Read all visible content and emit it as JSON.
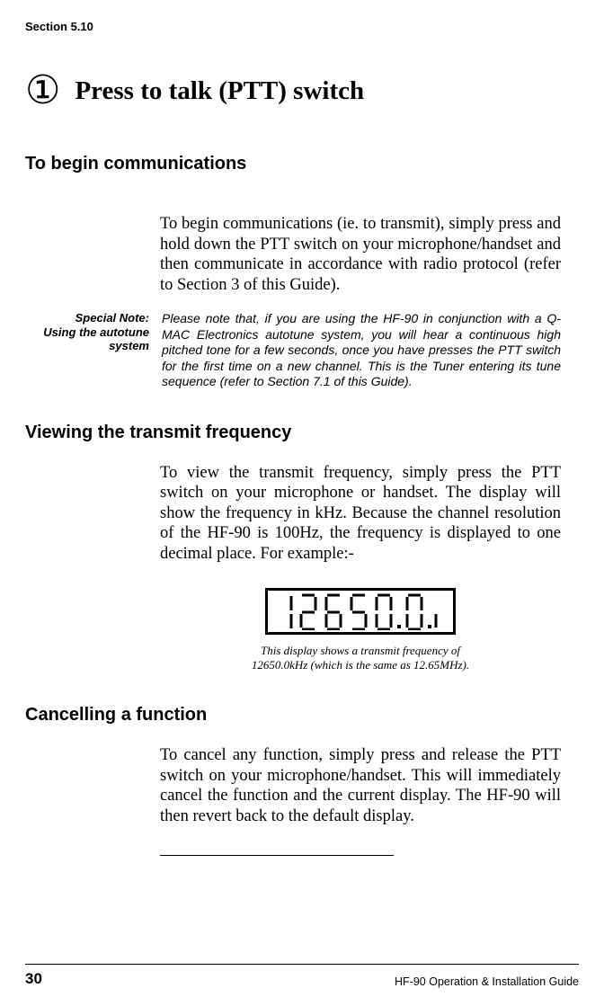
{
  "header": {
    "section_ref": "Section 5.10"
  },
  "main": {
    "circled_number": "①",
    "title": "Press to talk (PTT) switch"
  },
  "sections": {
    "begin": {
      "heading": "To begin communications",
      "body": "To begin communications (ie. to transmit), simply press and hold down the PTT switch on your microphone/handset and then communicate in accordance with radio protocol (refer to Section 3 of this Guide)."
    },
    "note": {
      "label_line1": "Special Note:",
      "label_line2": "Using the autotune system",
      "body": "Please note that, if you are using the HF-90 in conjunction with a Q-MAC Electronics autotune system, you will hear a continuous high pitched tone for a few seconds, once you have presses the PTT switch for the first time on a new channel.  This is the Tuner entering its tune sequence (refer to Section 7.1 of this Guide)."
    },
    "viewing": {
      "heading": "Viewing the transmit frequency",
      "body": "To view the transmit frequency, simply press the PTT switch on your microphone or handset.  The display will show the frequency in kHz.  Because the channel resolution of the HF-90 is 100Hz, the frequency is displayed to one decimal place.  For example:-"
    },
    "display": {
      "value": "12650.0",
      "caption_line1": "This display shows a transmit frequency of",
      "caption_line2": "12650.0kHz (which is the same as 12.65MHz)."
    },
    "cancel": {
      "heading": "Cancelling a function",
      "body": "To cancel any function, simply press and release the PTT switch on your microphone/handset.  This will immediately cancel the function and the current display.  The HF-90 will then revert back to the default display."
    }
  },
  "footer": {
    "page": "30",
    "title": "HF-90 Operation & Installation Guide"
  }
}
